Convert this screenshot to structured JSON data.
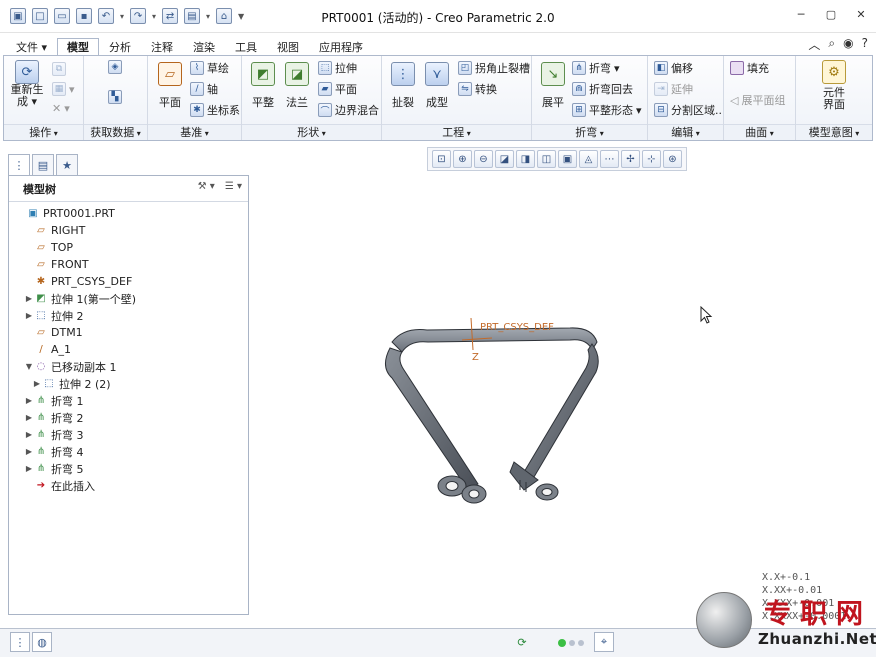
{
  "window": {
    "title": "PRT0001 (活动的) - Creo Parametric 2.0",
    "controls": [
      "─",
      "▢",
      "✕"
    ]
  },
  "quick_access": [
    "new-icon",
    "open-icon",
    "save-icon",
    "undo-icon",
    "redo-icon",
    "regenerate-icon",
    "windows-icon",
    "close-window-icon",
    "customize-icon"
  ],
  "tabs": [
    "文件 ▾",
    "模型",
    "分析",
    "注释",
    "渲染",
    "工具",
    "视图",
    "应用程序"
  ],
  "active_tab": "模型",
  "ribbon": {
    "groups": {
      "operations": {
        "label": "操作",
        "regenerate": "重新生\n成 ▾"
      },
      "get_data": {
        "label": "获取数据"
      },
      "datum": {
        "label": "基准",
        "plane": "平面",
        "sketch": "草绘",
        "axis": "轴",
        "csys": "坐标系"
      },
      "shapes": {
        "label": "形状",
        "flat": "平整",
        "flange": "法兰",
        "extrude": "拉伸",
        "planar": "平面",
        "blend": "边界混合"
      },
      "engineering": {
        "label": "工程",
        "rip": "扯裂",
        "form": "成型",
        "corner_relief": "拐角止裂槽",
        "convert": "转换"
      },
      "bends": {
        "label": "折弯",
        "unbend": "展平",
        "bend": "折弯",
        "bend_back": "折弯回去",
        "flat_state": "平整形态"
      },
      "editing": {
        "label": "编辑",
        "offset": "偏移",
        "extend": "延伸",
        "split_area": "分割区域.."
      },
      "surfaces": {
        "label": "曲面",
        "fill": "填充",
        "flatten_quilt": "展平面组"
      },
      "model_intent": {
        "label": "模型意图",
        "component_interface": "元件\n界面"
      }
    }
  },
  "model_tree": {
    "title": "模型树",
    "items": [
      {
        "label": "PRT0001.PRT",
        "indent": 0,
        "expand": "",
        "icon": "part-icon"
      },
      {
        "label": "RIGHT",
        "indent": 1,
        "expand": "",
        "icon": "datum-plane-icon"
      },
      {
        "label": "TOP",
        "indent": 1,
        "expand": "",
        "icon": "datum-plane-icon"
      },
      {
        "label": "FRONT",
        "indent": 1,
        "expand": "",
        "icon": "datum-plane-icon"
      },
      {
        "label": "PRT_CSYS_DEF",
        "indent": 1,
        "expand": "",
        "icon": "csys-icon"
      },
      {
        "label": "拉伸 1(第一个壁)",
        "indent": 1,
        "expand": "▶",
        "icon": "extrude-wall-icon"
      },
      {
        "label": "拉伸 2",
        "indent": 1,
        "expand": "▶",
        "icon": "extrude-icon"
      },
      {
        "label": "DTM1",
        "indent": 1,
        "expand": "",
        "icon": "datum-plane-icon"
      },
      {
        "label": "A_1",
        "indent": 1,
        "expand": "",
        "icon": "axis-icon"
      },
      {
        "label": "已移动副本 1",
        "indent": 1,
        "expand": "▼",
        "icon": "moved-copy-icon"
      },
      {
        "label": "拉伸 2 (2)",
        "indent": 2,
        "expand": "▶",
        "icon": "extrude-icon"
      },
      {
        "label": "折弯 1",
        "indent": 1,
        "expand": "▶",
        "icon": "bend-icon"
      },
      {
        "label": "折弯 2",
        "indent": 1,
        "expand": "▶",
        "icon": "bend-icon"
      },
      {
        "label": "折弯 3",
        "indent": 1,
        "expand": "▶",
        "icon": "bend-icon"
      },
      {
        "label": "折弯 4",
        "indent": 1,
        "expand": "▶",
        "icon": "bend-icon"
      },
      {
        "label": "折弯 5",
        "indent": 1,
        "expand": "▶",
        "icon": "bend-icon"
      },
      {
        "label": "在此插入",
        "indent": 1,
        "expand": "",
        "icon": "insert-here-icon"
      }
    ]
  },
  "view_toolbar": [
    "refit-icon",
    "zoom-in-icon",
    "zoom-out-icon",
    "repaint-icon",
    "display-style-icon",
    "saved-views-icon",
    "view-manager-icon",
    "perspective-icon",
    "datum-display-icon",
    "csys-display-icon",
    "spin-center-icon",
    "annotation-display-icon"
  ],
  "canvas": {
    "csys_label": "PRT_CSYS_DEF",
    "axis_z": "Z",
    "tolerances": [
      "X.X+-0.1",
      "X.XX+-0.01",
      "X.XXX+-0.001",
      "X.XXXX+-0.0001"
    ]
  },
  "watermark": {
    "cn": "专职网",
    "en": "Zhuanzhi.Net"
  },
  "colors": {
    "accent": "#2f5b98",
    "part": "#5b6068",
    "csys": "#c26a2a",
    "watermark_red": "#c0141e"
  }
}
